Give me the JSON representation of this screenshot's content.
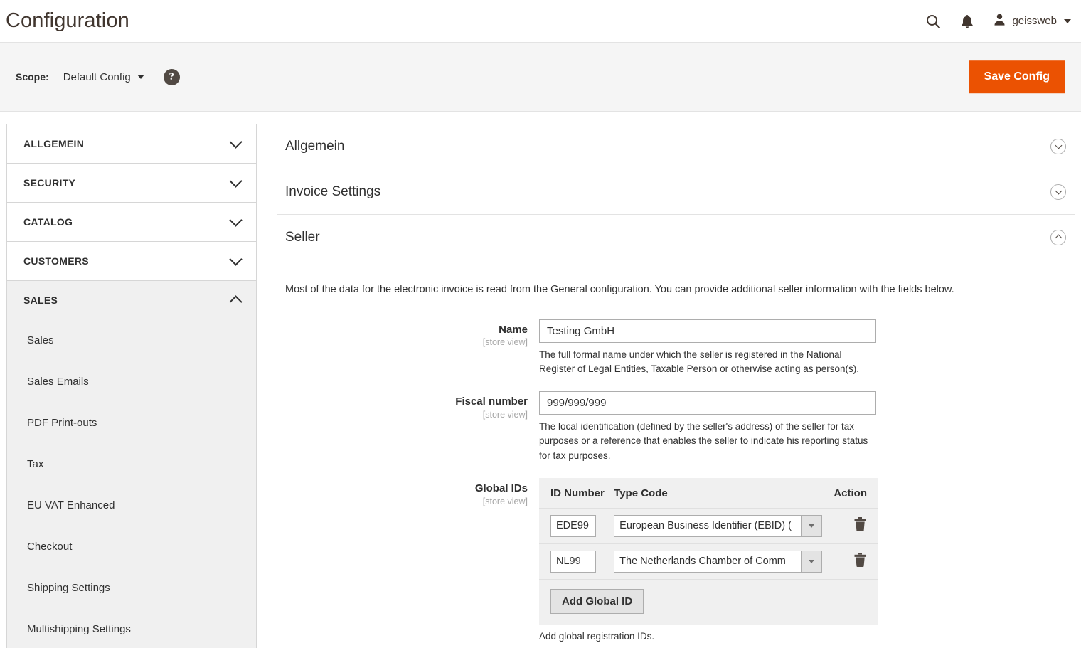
{
  "header": {
    "title": "Configuration",
    "search_icon": "search-icon",
    "notifications_icon": "bell-icon",
    "user_icon": "user-avatar-icon",
    "user_name": "geissweb"
  },
  "scope_bar": {
    "label": "Scope:",
    "selected": "Default Config",
    "help_glyph": "?",
    "save_label": "Save Config",
    "accent_color": "#eb5202"
  },
  "sidebar": {
    "sections": [
      {
        "label": "ALLGEMEIN",
        "open": false,
        "items": []
      },
      {
        "label": "SECURITY",
        "open": false,
        "items": []
      },
      {
        "label": "CATALOG",
        "open": false,
        "items": []
      },
      {
        "label": "CUSTOMERS",
        "open": false,
        "items": []
      },
      {
        "label": "SALES",
        "open": true,
        "items": [
          "Sales",
          "Sales Emails",
          "PDF Print-outs",
          "Tax",
          "EU VAT Enhanced",
          "Checkout",
          "Shipping Settings",
          "Multishipping Settings"
        ]
      }
    ]
  },
  "main": {
    "sections": [
      {
        "title": "Allgemein",
        "expanded": false
      },
      {
        "title": "Invoice Settings",
        "expanded": false
      },
      {
        "title": "Seller",
        "expanded": true
      }
    ],
    "seller": {
      "intro": "Most of the data for the electronic invoice is read from the General configuration. You can provide additional seller information with the fields below.",
      "scope_note": "[store view]",
      "name_field": {
        "label": "Name",
        "value": "Testing GmbH",
        "note": "The full formal name under which the seller is registered in the National Register of Legal Entities, Taxable Person or otherwise acting as person(s)."
      },
      "fiscal_field": {
        "label": "Fiscal number",
        "value": "999/999/999",
        "note": "The local identification (defined by the seller's address) of the seller for tax purposes or a reference that enables the seller to indicate his reporting status for tax purposes."
      },
      "global_ids": {
        "label": "Global IDs",
        "columns": [
          "ID Number",
          "Type Code",
          "Action"
        ],
        "rows": [
          {
            "id_number": "EDE99",
            "type_code": "European Business Identifier (EBID) ("
          },
          {
            "id_number": "NL99",
            "type_code": "The Netherlands Chamber of Comm"
          }
        ],
        "add_label": "Add Global ID",
        "note": "Add global registration IDs."
      }
    }
  }
}
